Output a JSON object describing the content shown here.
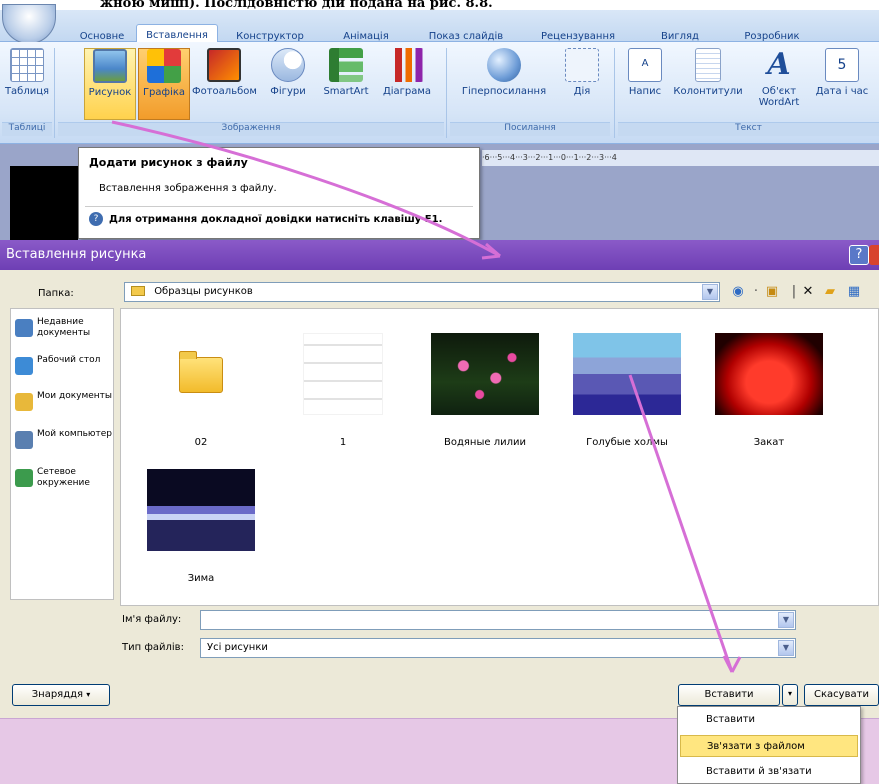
{
  "top_caption": "жною миші). Послідовністю дій подана на рис. 8.8.",
  "ribbon": {
    "tabs": [
      "Основне",
      "Вставлення",
      "Конструктор",
      "Анімація",
      "Показ слайдів",
      "Рецензування",
      "Вигляд",
      "Розробник"
    ],
    "active_tab": "Вставлення",
    "buttons": {
      "table": "Таблиця",
      "picture": "Рисунок",
      "clipart": "Графіка",
      "photoalbum": "Фотоальбом",
      "shapes": "Фігури",
      "smartart": "SmartArt",
      "chart": "Діаграма",
      "hyperlink": "Гіперпосилання",
      "action": "Дія",
      "textbox": "Напис",
      "header_footer": "Колонтитули",
      "wordart": "Об'єкт WordArt",
      "datetime": "Дата і час"
    },
    "groups": {
      "tables": "Таблиці",
      "images": "Зображення",
      "links": "Посилання",
      "text": "Текст"
    }
  },
  "tooltip": {
    "title": "Додати рисунок з файлу",
    "body": "Вставлення зображення з файлу.",
    "help": "Для отримання докладної довідки натисніть клавішу F1."
  },
  "ruler_text": "·6···5···4···3···2···1···0···1···2···3···4",
  "dialog": {
    "title": "Вставлення рисунка",
    "help_label": "?",
    "folder_label": "Папка:",
    "folder_value": "Образцы рисунков",
    "places": [
      {
        "label": "Недавние документы",
        "icon": "recent-documents-icon",
        "color": "#4a7fc1"
      },
      {
        "label": "Рабочий стол",
        "icon": "desktop-icon",
        "color": "#3d8bd6"
      },
      {
        "label": "Мои документы",
        "icon": "my-documents-icon",
        "color": "#e8b83a"
      },
      {
        "label": "Мой компьютер",
        "icon": "my-computer-icon",
        "color": "#5a7fb0"
      },
      {
        "label": "Сетевое окружение",
        "icon": "network-icon",
        "color": "#3c9b4d"
      }
    ],
    "files": [
      {
        "name": "02",
        "kind": "folder-icon"
      },
      {
        "name": "1",
        "kind": "document-thumbnail"
      },
      {
        "name": "Водяные лилии",
        "kind": "water-lilies-thumbnail"
      },
      {
        "name": "Голубые холмы",
        "kind": "blue-hills-thumbnail"
      },
      {
        "name": "Закат",
        "kind": "sunset-thumbnail"
      },
      {
        "name": "Зима",
        "kind": "winter-thumbnail"
      }
    ],
    "filename_label": "Ім'я файлу:",
    "filename_value": "",
    "filetype_label": "Тип файлів:",
    "filetype_value": "Усі рисунки",
    "tools_button": "Знаряддя",
    "insert_button": "Вставити",
    "cancel_button": "Скасувати",
    "insert_menu": [
      "Вставити",
      "Зв'язати з файлом",
      "Вставити й зв'язати"
    ],
    "selected_menu_item": "Зв'язати з файлом"
  },
  "colors": {
    "dialog_title_bg": "#6e3fb4",
    "arrow": "#d66fd6",
    "highlight": "#ffd24d"
  }
}
